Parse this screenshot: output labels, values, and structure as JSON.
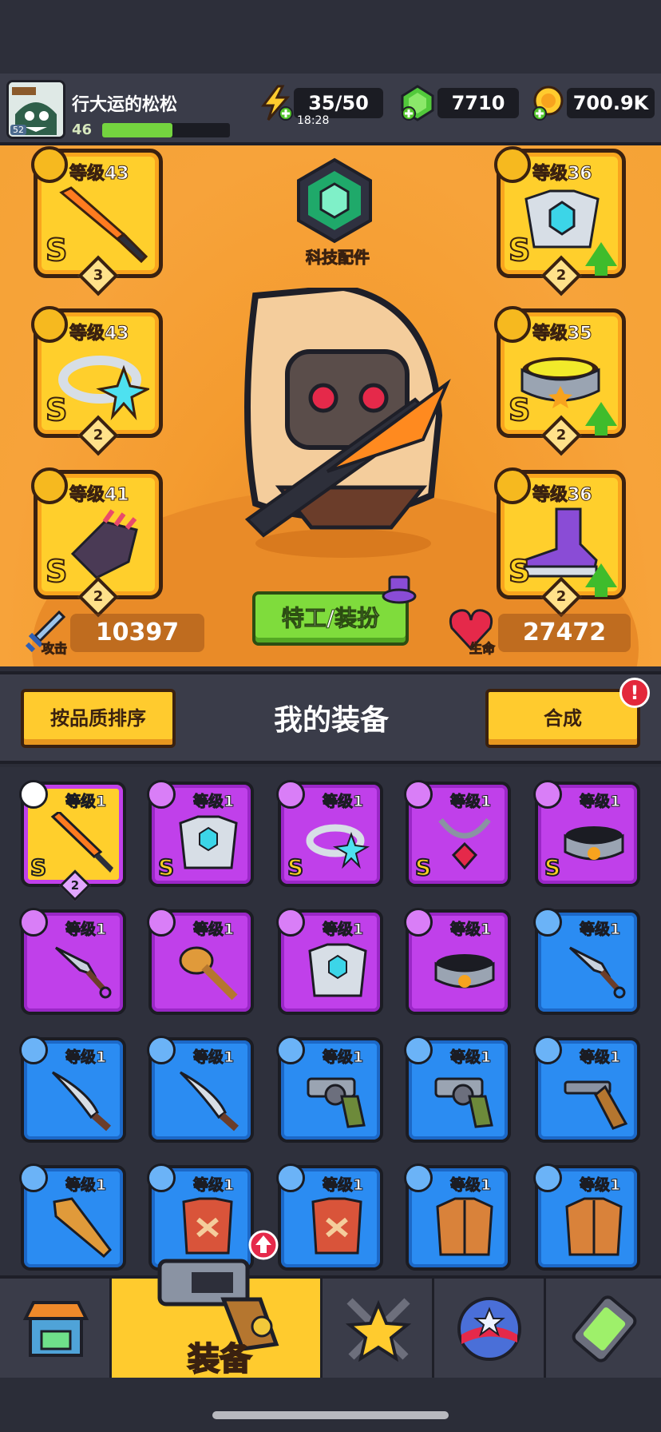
{
  "player": {
    "name": "行大运的松松",
    "level": "46",
    "avatar_badge": "52",
    "xp_fraction": 0.55
  },
  "resources": {
    "energy": "35/50",
    "energy_timer": "18:28",
    "gems": "7710",
    "gold": "700.9K"
  },
  "equipment": {
    "left_slots": [
      {
        "level": "等级43",
        "grade": "S",
        "stars": "3",
        "item": "sword-icon"
      },
      {
        "level": "等级43",
        "grade": "S",
        "stars": "2",
        "item": "ring-icon"
      },
      {
        "level": "等级41",
        "grade": "S",
        "stars": "2",
        "item": "gauntlet-icon"
      }
    ],
    "right_slots": [
      {
        "level": "等级36",
        "grade": "S",
        "stars": "2",
        "item": "armor-icon",
        "upgrade": true
      },
      {
        "level": "等级35",
        "grade": "S",
        "stars": "2",
        "item": "belt-icon",
        "upgrade": true
      },
      {
        "level": "等级36",
        "grade": "S",
        "stars": "2",
        "item": "boots-icon",
        "upgrade": true
      }
    ],
    "tech_label": "科技配件",
    "agent_button": "特工/装扮",
    "attack_label": "攻击",
    "attack_value": "10397",
    "hp_label": "生命",
    "hp_value": "27472"
  },
  "inventory_header": {
    "sort_button": "按品质排序",
    "title": "我的装备",
    "merge_button": "合成",
    "alert": "!"
  },
  "inventory": [
    {
      "level": "等级1",
      "rarity": "selected",
      "grade": "S",
      "stars": "2",
      "item": "sword-icon"
    },
    {
      "level": "等级1",
      "rarity": "purple",
      "grade": "S",
      "item": "armor-icon"
    },
    {
      "level": "等级1",
      "rarity": "purple",
      "grade": "S",
      "item": "ring-icon"
    },
    {
      "level": "等级1",
      "rarity": "purple",
      "grade": "S",
      "item": "necklace-icon"
    },
    {
      "level": "等级1",
      "rarity": "purple",
      "grade": "S",
      "item": "belt-icon"
    },
    {
      "level": "等级1",
      "rarity": "purple",
      "item": "kunai-icon"
    },
    {
      "level": "等级1",
      "rarity": "purple",
      "item": "club-icon"
    },
    {
      "level": "等级1",
      "rarity": "purple",
      "item": "armor-icon"
    },
    {
      "level": "等级1",
      "rarity": "purple",
      "item": "belt-icon"
    },
    {
      "level": "等级1",
      "rarity": "blue",
      "item": "kunai-icon"
    },
    {
      "level": "等级1",
      "rarity": "blue",
      "item": "machete-icon"
    },
    {
      "level": "等级1",
      "rarity": "blue",
      "item": "machete-icon"
    },
    {
      "level": "等级1",
      "rarity": "blue",
      "item": "revolver-icon"
    },
    {
      "level": "等级1",
      "rarity": "blue",
      "item": "revolver-icon"
    },
    {
      "level": "等级1",
      "rarity": "blue",
      "item": "shotgun-icon"
    },
    {
      "level": "等级1",
      "rarity": "blue",
      "item": "bat-icon"
    },
    {
      "level": "等级1",
      "rarity": "blue",
      "item": "vest-icon"
    },
    {
      "level": "等级1",
      "rarity": "blue",
      "item": "vest-icon"
    },
    {
      "level": "等级1",
      "rarity": "blue",
      "item": "jacket-icon"
    },
    {
      "level": "等级1",
      "rarity": "blue",
      "item": "jacket-icon"
    }
  ],
  "nav": {
    "active_label": "装备",
    "items": [
      "shop-icon",
      "equipment-icon",
      "battle-icon",
      "orb-icon",
      "dna-icon"
    ]
  }
}
